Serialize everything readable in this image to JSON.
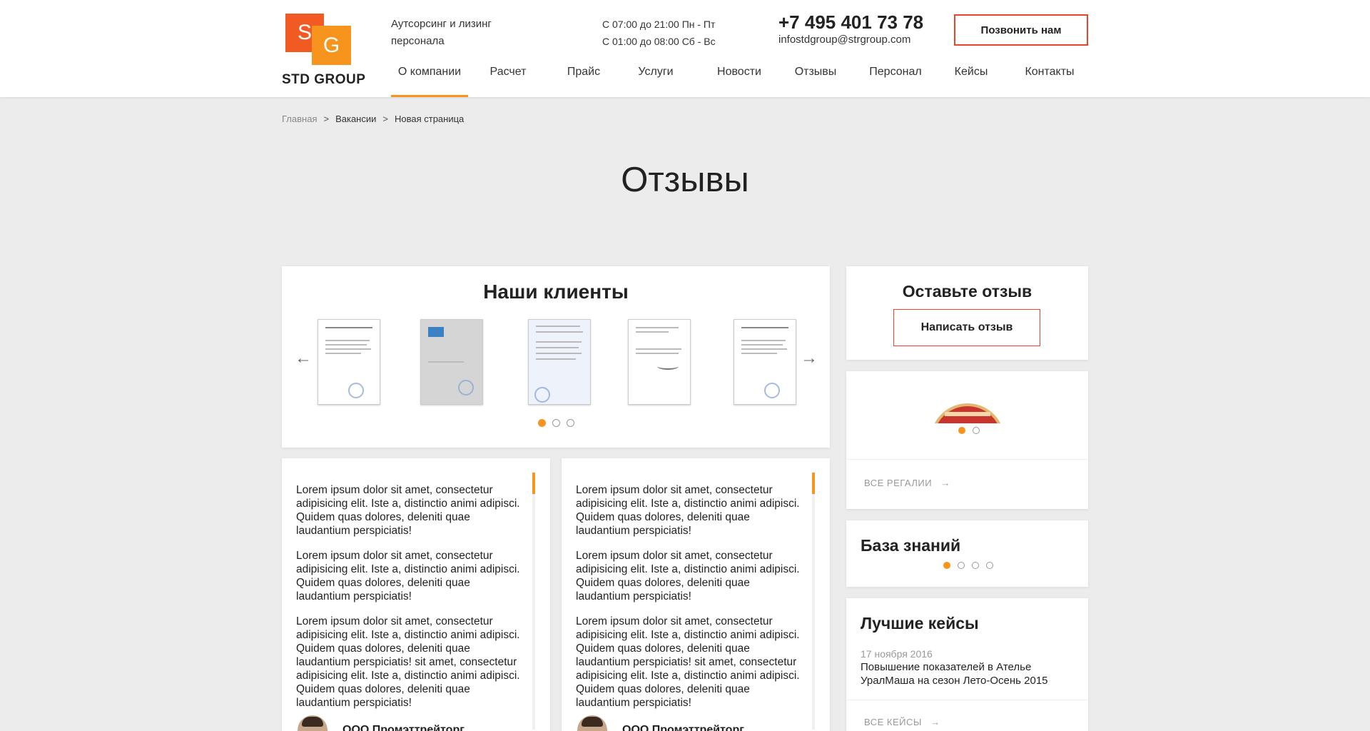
{
  "header": {
    "logo": {
      "letter1": "S",
      "letter2": "G",
      "text": "STD GROUP"
    },
    "tagline": "Аутсорсинг и лизинг персонала",
    "hours": [
      "С 07:00 до 21:00 Пн - Пт",
      "С 01:00 до 08:00 Сб - Вс"
    ],
    "phone": "+7 495 401 73 78",
    "email": "infostdgroup@strgroup.com",
    "call_button": "Позвонить нам"
  },
  "nav": {
    "items": [
      "О компании",
      "Расчет",
      "Прайс",
      "Услуги",
      "Новости",
      "Отзывы",
      "Персонал",
      "Кейсы",
      "Контакты"
    ],
    "active": "О компании"
  },
  "breadcrumb": {
    "home": "Главная",
    "sep": ">",
    "items": [
      "Вакансии",
      "Новая страница"
    ]
  },
  "page_title": "Отзывы",
  "clients": {
    "title": "Наши клиенты",
    "prev_arrow": "←",
    "next_arrow": "→",
    "dots_total": 3,
    "dots_active": 0
  },
  "reviews": [
    {
      "paragraphs": [
        "Lorem ipsum dolor sit amet, consectetur adipisicing elit. Iste a, distinctio animi adipisci. Quidem quas dolores, deleniti quae laudantium perspiciatis!",
        "Lorem ipsum dolor sit amet, consectetur adipisicing elit. Iste a, distinctio animi adipisci. Quidem quas dolores, deleniti quae laudantium perspiciatis!",
        "Lorem ipsum dolor sit amet, consectetur adipisicing elit. Iste a, distinctio animi adipisci. Quidem quas dolores, deleniti quae laudantium perspiciatis! sit amet, consectetur adipisicing elit. Iste a, distinctio animi adipisci. Quidem quas dolores, deleniti quae laudantium perspiciatis!"
      ],
      "author": "ООО Промэттрейторг"
    },
    {
      "paragraphs": [
        "Lorem ipsum dolor sit amet, consectetur adipisicing elit. Iste a, distinctio animi adipisci. Quidem quas dolores, deleniti quae laudantium perspiciatis!",
        "Lorem ipsum dolor sit amet, consectetur adipisicing elit. Iste a, distinctio animi adipisci. Quidem quas dolores, deleniti quae laudantium perspiciatis!",
        "Lorem ipsum dolor sit amet, consectetur adipisicing elit. Iste a, distinctio animi adipisci. Quidem quas dolores, deleniti quae laudantium perspiciatis! sit amet, consectetur adipisicing elit. Iste a, distinctio animi adipisci. Quidem quas dolores, deleniti quae laudantium perspiciatis!"
      ],
      "author": "ООО Промэттрейторг"
    }
  ],
  "leave_review": {
    "title": "Оставьте отзыв",
    "button": "Написать отзыв"
  },
  "awards": {
    "dots_total": 2,
    "dots_active": 0,
    "all_link": "ВСЕ РЕГАЛИИ"
  },
  "knowledge_base": {
    "title": "База знаний",
    "dots_total": 4,
    "dots_active": 0
  },
  "best_cases": {
    "title": "Лучшие кейсы",
    "date": "17 ноября 2016",
    "case_title": "Повышение показателей в Ателье УралМаша на сезон Лето-Осень 2015",
    "all_link": "ВСЕ КЕЙСЫ"
  },
  "colors": {
    "accent": "#f7941d",
    "brand_red": "#e8452a",
    "page_bg": "#ececec"
  }
}
